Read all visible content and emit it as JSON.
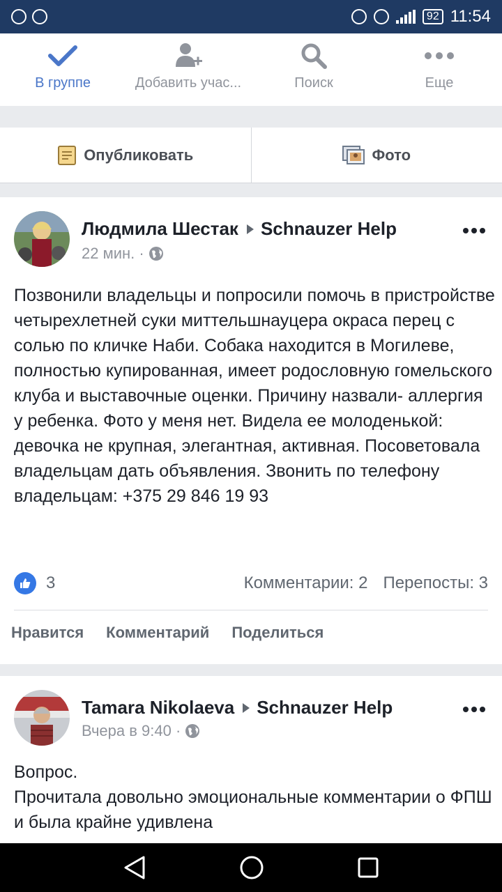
{
  "status_bar": {
    "battery": "92",
    "time": "11:54"
  },
  "tabs": [
    {
      "label": "В группе",
      "icon": "checkmark-icon",
      "active": true
    },
    {
      "label": "Добавить учас...",
      "icon": "add-person-icon",
      "active": false
    },
    {
      "label": "Поиск",
      "icon": "search-icon",
      "active": false
    },
    {
      "label": "Еще",
      "icon": "more-icon",
      "active": false
    }
  ],
  "composer": {
    "publish_label": "Опубликовать",
    "photo_label": "Фото"
  },
  "posts": [
    {
      "author": "Людмила Шестак",
      "group": "Schnauzer Help",
      "time": "22 мин. ·",
      "text": "Позвонили владельцы и попросили помочь в пристройстве четырехлетней суки миттельшнауцера окраса перец с солью по кличке Наби. Собака находится в Могилеве, полностью купированная, имеет родословную гомельского клуба и выставочные оценки. Причину назвали- аллергия у ребенка. Фото у меня нет. Видела ее молоденькой: девочка не крупная, элегантная, активная. Посоветовала владельцам дать объявления. Звонить по телефону владельцам: +375 29 846 19 93",
      "likes": "3",
      "comments": "Комментарии: 2",
      "shares": "Перепосты: 3",
      "actions": {
        "like": "Нравится",
        "comment": "Комментарий",
        "share": "Поделиться"
      }
    },
    {
      "author": "Tamara Nikolaeva",
      "group": "Schnauzer Help",
      "time": "Вчера в 9:40 ·",
      "text": "Вопрос.\nПрочитала довольно эмоциональные комментарии о ФПШ и была крайне удивлена"
    }
  ],
  "colors": {
    "status_bar": "#1f3a63",
    "accent": "#4a76c8",
    "like_blue": "#3578e5"
  }
}
